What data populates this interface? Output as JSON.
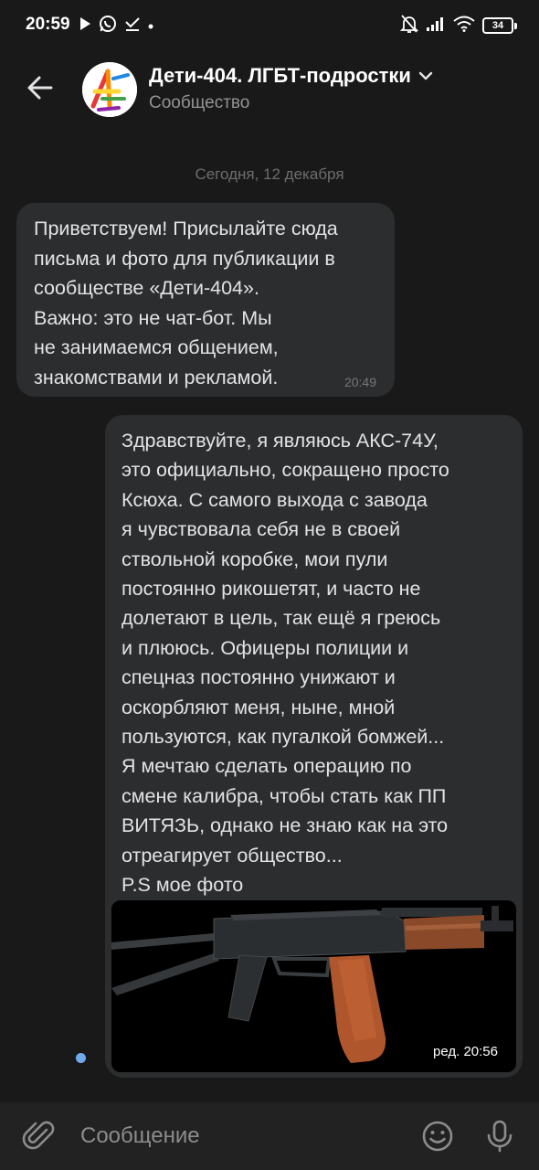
{
  "status_bar": {
    "time": "20:59",
    "battery": "34",
    "icons": [
      "play-icon",
      "whatsapp-icon",
      "download-done-icon",
      "dot-icon",
      "bell-off-icon",
      "signal-icon",
      "wifi-icon",
      "battery-icon"
    ]
  },
  "header": {
    "title": "Дети-404. ЛГБТ-подростки",
    "subtitle": "Сообщество",
    "avatar_text": "404"
  },
  "date_separator": "Сегодня, 12 декабря",
  "messages": [
    {
      "direction": "incoming",
      "text": "Приветствуем! Присылайте сюда\nписьма и фото для публикации в\nсообществе «Дети-404».\nВажно: это не чат-бот. Мы\nне занимаемся общением,\nзнакомствами и рекламой.",
      "time": "20:49"
    },
    {
      "direction": "outgoing",
      "text": "Здравствуйте, я являюсь АКС-74У,\nэто официально, сокращено просто\nКсюха. С самого выхода с завода\nя чувствовала себя не в своей\nствольной коробке, мои пули\nпостоянно рикошетят, и часто не\nдолетают в цель, так ещё я греюсь\nи плююсь. Офицеры полиции и\nспецназ постоянно унижают и\nоскорбляют меня, ныне, мной\nпользуются, как пугалкой бомжей...\nЯ мечтаю сделать операцию по\nсмене калибра, чтобы стать как ПП\nВИТЯЗЬ, однако не знаю как на это\nотреагирует общество...\nP.S мое фото",
      "edited_time": "ред. 20:56",
      "unread": true
    }
  ],
  "composer": {
    "placeholder": "Сообщение"
  },
  "colors": {
    "background": "#191919",
    "bubble": "#2c2d2e",
    "accent": "#71aaeb",
    "composer": "#222222"
  }
}
